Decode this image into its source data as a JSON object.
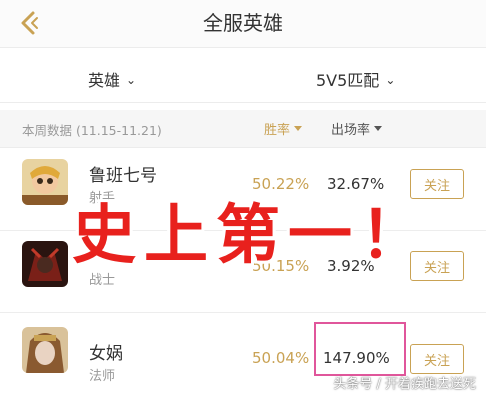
{
  "header": {
    "title": "全服英雄"
  },
  "filters": {
    "category": "英雄",
    "mode": "5V5匹配"
  },
  "stats": {
    "period": "本周数据 (11.15-11.21)",
    "win_rate_label": "胜率",
    "pick_rate_label": "出场率"
  },
  "heroes": [
    {
      "name": "鲁班七号",
      "role": "射手",
      "win_rate": "50.22%",
      "pick_rate": "32.67%",
      "follow_label": "关注",
      "avatar_color": "#d9b36a"
    },
    {
      "name": "",
      "role": "战士",
      "win_rate": "50.15%",
      "pick_rate": "3.92%",
      "follow_label": "关注",
      "avatar_color": "#6b1f1a"
    },
    {
      "name": "女娲",
      "role": "法师",
      "win_rate": "50.04%",
      "pick_rate": "147.90%",
      "follow_label": "关注",
      "avatar_color": "#b58a52"
    }
  ],
  "overlay": {
    "caption": "史上第一！"
  },
  "watermark": "头条号 / 开着疾跑去送死",
  "colors": {
    "accent": "#c9a254",
    "overlay_red": "#e8211d",
    "highlight": "#e0569b"
  }
}
